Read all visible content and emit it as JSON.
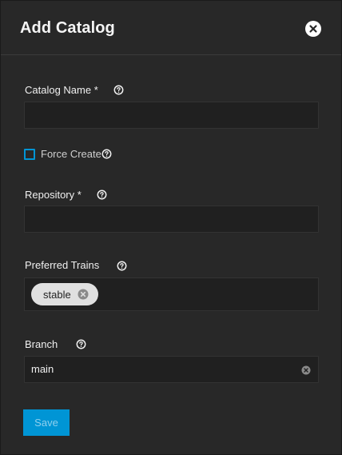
{
  "dialog": {
    "title": "Add Catalog",
    "close_icon": "close-icon"
  },
  "fields": {
    "catalog_name": {
      "label": "Catalog Name *",
      "value": ""
    },
    "force_create": {
      "label": "Force Create",
      "checked": false
    },
    "repository": {
      "label": "Repository *",
      "value": ""
    },
    "preferred_trains": {
      "label": "Preferred Trains",
      "chips": [
        "stable"
      ]
    },
    "branch": {
      "label": "Branch",
      "value": "main"
    }
  },
  "actions": {
    "save_label": "Save",
    "save_disabled": true
  },
  "colors": {
    "background": "#282828",
    "input": "#202020",
    "accent": "#0095d5",
    "chip": "#e0e0e0"
  }
}
